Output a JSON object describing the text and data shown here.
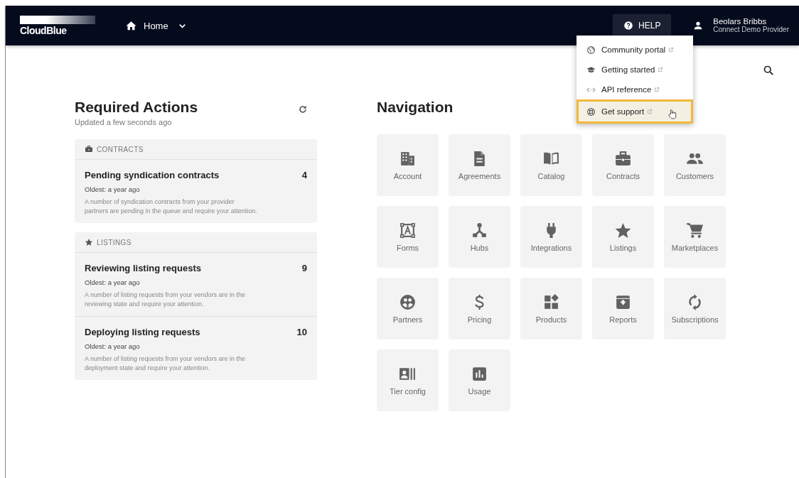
{
  "header": {
    "logo": "CloudBlue",
    "nav": {
      "label": "Home"
    },
    "help_button": "HELP",
    "user": {
      "name": "Beolars Bribbs",
      "account": "Connect Demo Provider"
    }
  },
  "help_menu": [
    {
      "label": "Community portal",
      "highlighted": false
    },
    {
      "label": "Getting started",
      "highlighted": false
    },
    {
      "label": "API reference",
      "highlighted": false
    },
    {
      "label": "Get support",
      "highlighted": true
    }
  ],
  "required_actions": {
    "title": "Required Actions",
    "updated": "Updated a few seconds ago",
    "groups": [
      {
        "kind": "contracts",
        "title": "CONTRACTS",
        "items": [
          {
            "title": "Pending syndication contracts",
            "count": "4",
            "oldest": "Oldest: a year ago",
            "description": "A number of syndication contracts from your provider partners are pending in the queue and require your attention."
          }
        ]
      },
      {
        "kind": "listings",
        "title": "LISTINGS",
        "items": [
          {
            "title": "Reviewing listing requests",
            "count": "9",
            "oldest": "Oldest: a year ago",
            "description": "A number of listing requests from your vendors are in the reviewing state and require your attention."
          },
          {
            "title": "Deploying listing requests",
            "count": "10",
            "oldest": "Oldest: a year ago",
            "description": "A number of listing requests from your vendors are in the deployment state and require your attention."
          }
        ]
      }
    ]
  },
  "navigation": {
    "title": "Navigation",
    "tiles": [
      "Account",
      "Agreements",
      "Catalog",
      "Contracts",
      "Customers",
      "Forms",
      "Hubs",
      "Integrations",
      "Listings",
      "Marketplaces",
      "Partners",
      "Pricing",
      "Products",
      "Reports",
      "Subscriptions",
      "Tier config",
      "Usage"
    ]
  }
}
